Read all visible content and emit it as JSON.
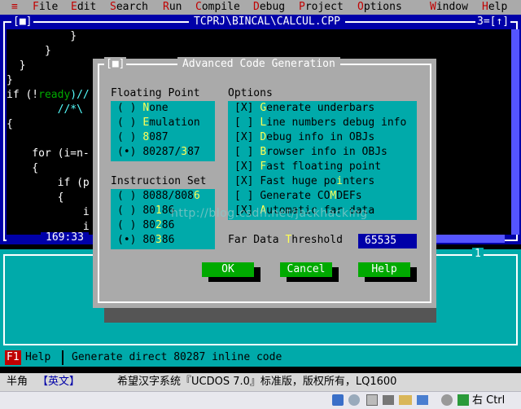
{
  "menubar": {
    "system": "≡",
    "items": [
      "File",
      "Edit",
      "Search",
      "Run",
      "Compile",
      "Debug",
      "Project",
      "Options",
      "Window",
      "Help"
    ]
  },
  "editor": {
    "left_marker": "[■]",
    "title": "TCPRJ\\BINCAL\\CALCUL.CPP",
    "window_num": "3=[↑]",
    "cursor_pos": "169:33",
    "code_lines": [
      {
        "pre": "          }",
        "post": ""
      },
      {
        "pre": "      }",
        "post": ""
      },
      {
        "pre": "  }",
        "post": ""
      },
      {
        "pre": "}",
        "post": ""
      },
      {
        "pre": "if (!",
        "kw": "ready",
        "post": ")//"
      },
      {
        "pre": "        //*\\",
        "post": ""
      },
      {
        "pre": "{",
        "post": ""
      },
      {
        "pre": "",
        "post": ""
      },
      {
        "pre": "    for (i=n-",
        "post": ""
      },
      {
        "pre": "    {",
        "post": ""
      },
      {
        "pre": "        if (p",
        "post": ""
      },
      {
        "pre": "        {",
        "post": ""
      },
      {
        "pre": "            i",
        "post": ""
      },
      {
        "pre": "            i",
        "post": ""
      }
    ]
  },
  "message_window": {
    "num": "1"
  },
  "dialog": {
    "title": "Advanced Code Generation",
    "close": "[■]",
    "floating_point": {
      "label": "Floating Point",
      "options": [
        {
          "mark": "( )",
          "pre": "",
          "hot": "N",
          "rest": "one"
        },
        {
          "mark": "( )",
          "pre": "",
          "hot": "E",
          "rest": "mulation"
        },
        {
          "mark": "( )",
          "pre": "",
          "hot": "8",
          "rest": "087"
        },
        {
          "mark": "(•)",
          "pre": "80287/",
          "hot": "3",
          "rest": "87"
        }
      ]
    },
    "instruction_set": {
      "label": "Instruction Set",
      "options": [
        {
          "mark": "( )",
          "pre": "8088/808",
          "hot": "6",
          "rest": ""
        },
        {
          "mark": "( )",
          "pre": "80",
          "hot": "1",
          "rest": "86"
        },
        {
          "mark": "( )",
          "pre": "80",
          "hot": "2",
          "rest": "86"
        },
        {
          "mark": "(•)",
          "pre": "80",
          "hot": "3",
          "rest": "86"
        }
      ]
    },
    "options": {
      "label": "Options",
      "items": [
        {
          "mark": "[X]",
          "pre": "",
          "hot": "G",
          "rest": "enerate underbars"
        },
        {
          "mark": "[ ]",
          "pre": "",
          "hot": "L",
          "rest": "ine numbers debug info"
        },
        {
          "mark": "[X]",
          "pre": "",
          "hot": "D",
          "rest": "ebug info in OBJs"
        },
        {
          "mark": "[ ]",
          "pre": "",
          "hot": "B",
          "rest": "rowser info in OBJs"
        },
        {
          "mark": "[X]",
          "pre": "",
          "hot": "F",
          "rest": "ast floating point"
        },
        {
          "mark": "[X]",
          "pre": "Fast huge po",
          "hot": "i",
          "rest": "nters"
        },
        {
          "mark": "[ ]",
          "pre": "Generate CO",
          "hot": "M",
          "rest": "DEFs"
        },
        {
          "mark": "[X]",
          "pre": "",
          "hot": "A",
          "rest": "utomatic far data"
        }
      ]
    },
    "threshold": {
      "pre": "Far Data ",
      "hot": "T",
      "rest": "hreshold",
      "value": "65535"
    },
    "buttons": {
      "ok": "OK",
      "cancel": "Cancel",
      "help": "Help"
    },
    "watermark": "http://blog.csdn.net/jackhacking"
  },
  "status": {
    "key": "F1",
    "key_label": "Help",
    "message": "Generate direct 80287 inline code"
  },
  "ucdos": {
    "mode": "半角",
    "ime": "【英文】",
    "text": "希望汉字系统『UCDOS 7.0』标准版，版权所有，LQ1600"
  },
  "taskbar": {
    "host_key": "右 Ctrl"
  },
  "colors": {
    "menu_bg": "#aaaaaa",
    "editor_bg": "#0000a8",
    "dialog_bg": "#aaaaaa",
    "panel_bg": "#00aaaa",
    "button_bg": "#00aa00",
    "highlight": "#ffff55",
    "hotkey": "#c00000"
  }
}
